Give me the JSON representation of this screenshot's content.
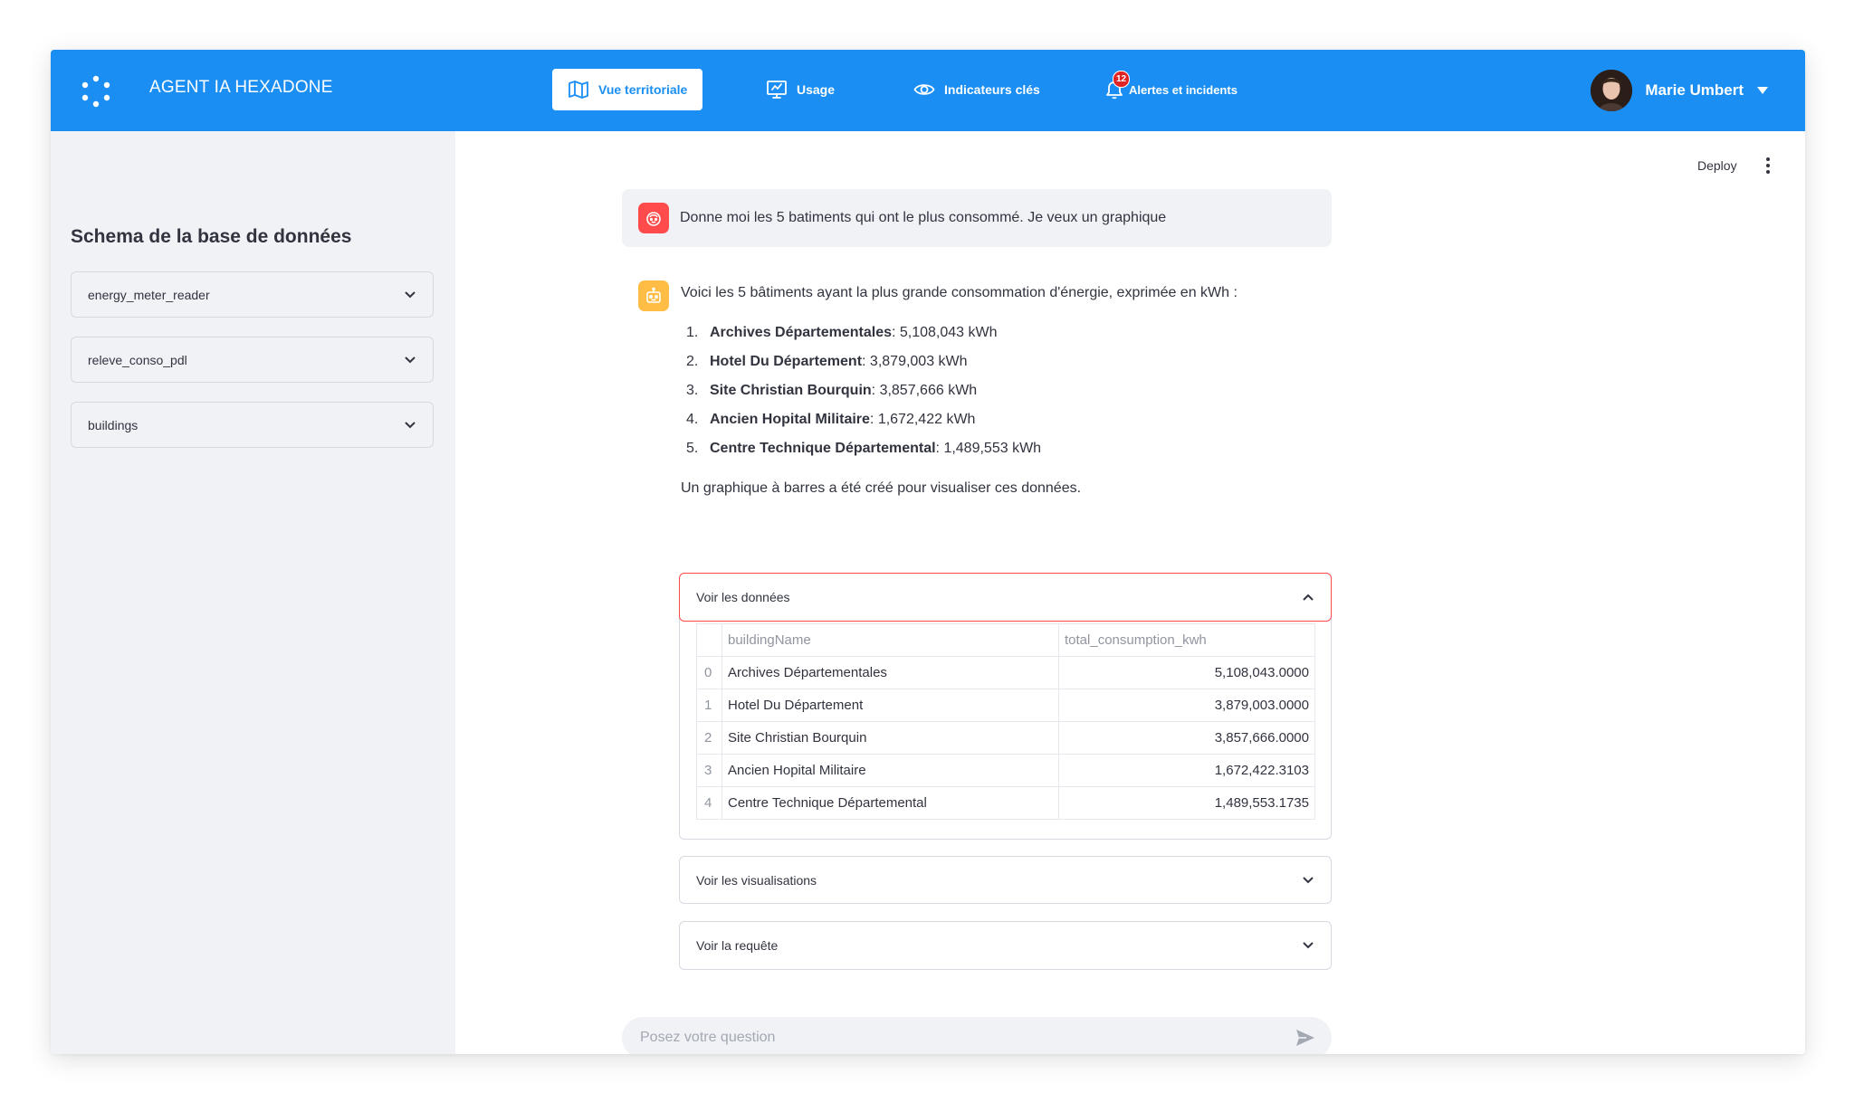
{
  "header": {
    "app_title": "AGENT IA HEXADONE",
    "nav": [
      {
        "label": "Vue territoriale",
        "icon": "map-icon",
        "active": true
      },
      {
        "label": "Usage",
        "icon": "monitor-chart-icon",
        "active": false
      },
      {
        "label": "Indicateurs clés",
        "icon": "eye-icon",
        "active": false
      },
      {
        "label": "Alertes et incidents",
        "icon": "bell-icon",
        "active": false,
        "badge": "12"
      }
    ],
    "user_name": "Marie Umbert",
    "accent_color": "#1a8ef2"
  },
  "sidebar": {
    "title": "Schema de la base de données",
    "tables": [
      {
        "label": "energy_meter_reader"
      },
      {
        "label": "releve_conso_pdl"
      },
      {
        "label": "buildings"
      }
    ]
  },
  "toolbar": {
    "deploy_label": "Deploy"
  },
  "chat": {
    "user_message": "Donne moi les 5 batiments qui ont le plus consommé. Je veux un graphique",
    "bot_intro": "Voici les 5 bâtiments ayant la plus grande consommation d'énergie, exprimée en kWh :",
    "ranking": [
      {
        "num": "1.",
        "name": "Archives Départementales",
        "value": " : 5,108,043 kWh"
      },
      {
        "num": "2.",
        "name": "Hotel Du Département",
        "value": " : 3,879,003 kWh"
      },
      {
        "num": "3.",
        "name": "Site Christian Bourquin",
        "value": " : 3,857,666 kWh"
      },
      {
        "num": "4.",
        "name": "Ancien Hopital Militaire",
        "value": " : 1,672,422 kWh"
      },
      {
        "num": "5.",
        "name": "Centre Technique Départemental",
        "value": " : 1,489,553 kWh"
      }
    ],
    "bot_outro": "Un graphique à barres a été créé pour visualiser ces données.",
    "expanders": {
      "data": {
        "label": "Voir les données",
        "columns": [
          "buildingName",
          "total_consumption_kwh"
        ],
        "rows": [
          {
            "index": "0",
            "name": "Archives Départementales",
            "value": "5,108,043.0000"
          },
          {
            "index": "1",
            "name": "Hotel Du Département",
            "value": "3,879,003.0000"
          },
          {
            "index": "2",
            "name": "Site Christian Bourquin",
            "value": "3,857,666.0000"
          },
          {
            "index": "3",
            "name": "Ancien Hopital Militaire",
            "value": "1,672,422.3103"
          },
          {
            "index": "4",
            "name": "Centre Technique Départemental",
            "value": "1,489,553.1735"
          }
        ]
      },
      "visualisations": {
        "label": "Voir les visualisations"
      },
      "query": {
        "label": "Voir la requête"
      }
    },
    "input_placeholder": "Posez votre question"
  }
}
